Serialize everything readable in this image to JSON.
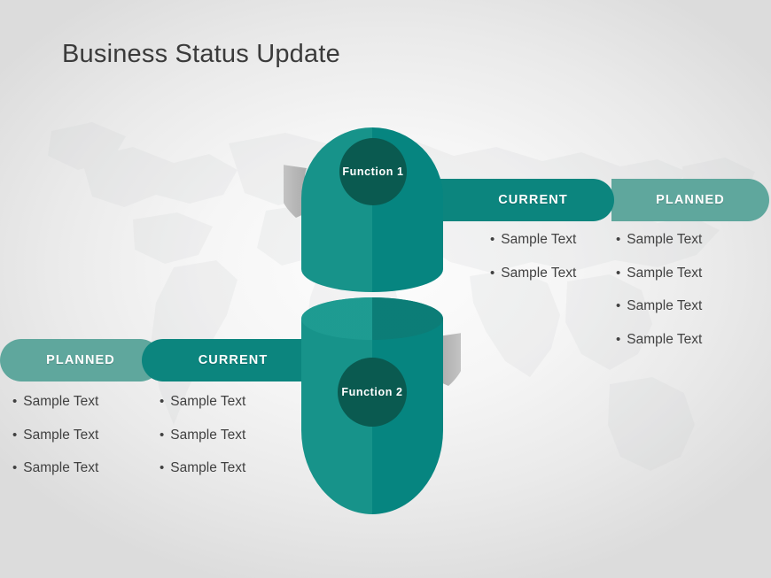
{
  "slide": {
    "title": "Business Status Update",
    "background_color": "#efefef",
    "accent_dark": "#0c857e",
    "accent_light": "#5fa79d",
    "accent_deep": "#0a5a50",
    "ribbon_color": "#b5b5b5",
    "text_color": "#414141"
  },
  "watermark": {
    "name": "world-map"
  },
  "groups": [
    {
      "id": "function-1",
      "label": "Function  1",
      "position": "top",
      "columns": [
        {
          "id": "current",
          "header": "CURRENT",
          "style": "dark",
          "items": [
            "Sample Text",
            "Sample Text"
          ]
        },
        {
          "id": "planned",
          "header": "PLANNED",
          "style": "light",
          "items": [
            "Sample Text",
            "Sample Text",
            "Sample Text",
            "Sample Text"
          ]
        }
      ]
    },
    {
      "id": "function-2",
      "label": "Function  2",
      "position": "bottom",
      "columns": [
        {
          "id": "planned",
          "header": "PLANNED",
          "style": "light",
          "items": [
            "Sample Text",
            "Sample Text",
            "Sample Text"
          ]
        },
        {
          "id": "current",
          "header": "CURRENT",
          "style": "dark",
          "items": [
            "Sample Text",
            "Sample Text",
            "Sample Text"
          ]
        }
      ]
    }
  ]
}
